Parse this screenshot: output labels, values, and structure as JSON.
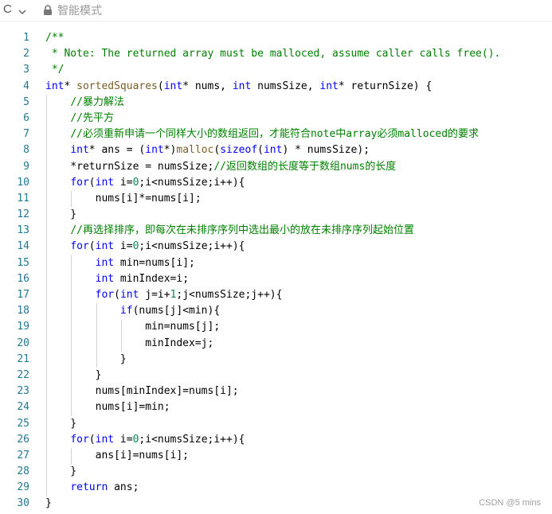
{
  "toolbar": {
    "language_label": "C",
    "mode_label": "智能模式",
    "icons": [
      "chevron-down-icon",
      "lock-icon"
    ]
  },
  "editor": {
    "lines": [
      {
        "n": "1",
        "tokens": [
          {
            "t": "/**",
            "c": "cm"
          }
        ]
      },
      {
        "n": "2",
        "tokens": [
          {
            "t": " * Note: The returned array must be malloced, assume caller calls free().",
            "c": "cm"
          }
        ]
      },
      {
        "n": "3",
        "tokens": [
          {
            "t": " */",
            "c": "cm"
          }
        ]
      },
      {
        "n": "4",
        "tokens": [
          {
            "t": "int",
            "c": "kw"
          },
          {
            "t": "* "
          },
          {
            "t": "sortedSquares",
            "c": "fn"
          },
          {
            "t": "("
          },
          {
            "t": "int",
            "c": "kw"
          },
          {
            "t": "* nums, "
          },
          {
            "t": "int",
            "c": "kw"
          },
          {
            "t": " numsSize, "
          },
          {
            "t": "int",
            "c": "kw"
          },
          {
            "t": "* returnSize) {"
          }
        ]
      },
      {
        "n": "5",
        "tokens": [
          {
            "t": "    "
          },
          {
            "t": "//暴力解法",
            "c": "cm"
          }
        ]
      },
      {
        "n": "6",
        "tokens": [
          {
            "t": "    "
          },
          {
            "t": "//先平方",
            "c": "cm"
          }
        ]
      },
      {
        "n": "7",
        "tokens": [
          {
            "t": "    "
          },
          {
            "t": "//必须重新申请一个同样大小的数组返回，才能符合note中array必须malloced的要求",
            "c": "cm"
          }
        ]
      },
      {
        "n": "8",
        "tokens": [
          {
            "t": "    "
          },
          {
            "t": "int",
            "c": "kw"
          },
          {
            "t": "* ans = ("
          },
          {
            "t": "int",
            "c": "kw"
          },
          {
            "t": "*)"
          },
          {
            "t": "malloc",
            "c": "fn"
          },
          {
            "t": "("
          },
          {
            "t": "sizeof",
            "c": "kw"
          },
          {
            "t": "("
          },
          {
            "t": "int",
            "c": "kw"
          },
          {
            "t": ") * numsSize);"
          }
        ]
      },
      {
        "n": "9",
        "tokens": [
          {
            "t": "    *returnSize = numsSize;"
          },
          {
            "t": "//返回数组的长度等于数组nums的长度",
            "c": "cm"
          }
        ]
      },
      {
        "n": "10",
        "tokens": [
          {
            "t": "    "
          },
          {
            "t": "for",
            "c": "kw"
          },
          {
            "t": "("
          },
          {
            "t": "int",
            "c": "kw"
          },
          {
            "t": " i="
          },
          {
            "t": "0",
            "c": "num"
          },
          {
            "t": ";i<numsSize;i++){"
          }
        ]
      },
      {
        "n": "11",
        "tokens": [
          {
            "t": "        nums[i]*=nums[i];"
          }
        ]
      },
      {
        "n": "12",
        "tokens": [
          {
            "t": "    }"
          }
        ]
      },
      {
        "n": "13",
        "tokens": [
          {
            "t": "    "
          },
          {
            "t": "//再选择排序，即每次在未排序序列中选出最小的放在未排序序列起始位置",
            "c": "cm"
          }
        ]
      },
      {
        "n": "14",
        "tokens": [
          {
            "t": "    "
          },
          {
            "t": "for",
            "c": "kw"
          },
          {
            "t": "("
          },
          {
            "t": "int",
            "c": "kw"
          },
          {
            "t": " i="
          },
          {
            "t": "0",
            "c": "num"
          },
          {
            "t": ";i<numsSize;i++){"
          }
        ]
      },
      {
        "n": "15",
        "tokens": [
          {
            "t": "        "
          },
          {
            "t": "int",
            "c": "kw"
          },
          {
            "t": " min=nums[i];"
          }
        ]
      },
      {
        "n": "16",
        "tokens": [
          {
            "t": "        "
          },
          {
            "t": "int",
            "c": "kw"
          },
          {
            "t": " minIndex=i;"
          }
        ]
      },
      {
        "n": "17",
        "tokens": [
          {
            "t": "        "
          },
          {
            "t": "for",
            "c": "kw"
          },
          {
            "t": "("
          },
          {
            "t": "int",
            "c": "kw"
          },
          {
            "t": " j=i+"
          },
          {
            "t": "1",
            "c": "num"
          },
          {
            "t": ";j<numsSize;j++){"
          }
        ]
      },
      {
        "n": "18",
        "tokens": [
          {
            "t": "            "
          },
          {
            "t": "if",
            "c": "kw"
          },
          {
            "t": "(nums[j]<min){"
          }
        ]
      },
      {
        "n": "19",
        "tokens": [
          {
            "t": "                min=nums[j];"
          }
        ]
      },
      {
        "n": "20",
        "tokens": [
          {
            "t": "                minIndex=j;"
          }
        ]
      },
      {
        "n": "21",
        "tokens": [
          {
            "t": "            }"
          }
        ]
      },
      {
        "n": "22",
        "tokens": [
          {
            "t": "        }"
          }
        ]
      },
      {
        "n": "23",
        "tokens": [
          {
            "t": "        nums[minIndex]=nums[i];"
          }
        ]
      },
      {
        "n": "24",
        "tokens": [
          {
            "t": "        nums[i]=min;"
          }
        ]
      },
      {
        "n": "25",
        "tokens": [
          {
            "t": "    }"
          }
        ]
      },
      {
        "n": "26",
        "tokens": [
          {
            "t": "    "
          },
          {
            "t": "for",
            "c": "kw"
          },
          {
            "t": "("
          },
          {
            "t": "int",
            "c": "kw"
          },
          {
            "t": " i="
          },
          {
            "t": "0",
            "c": "num"
          },
          {
            "t": ";i<numsSize;i++){"
          }
        ]
      },
      {
        "n": "27",
        "tokens": [
          {
            "t": "        ans[i]=nums[i];"
          }
        ]
      },
      {
        "n": "28",
        "tokens": [
          {
            "t": "    }"
          }
        ]
      },
      {
        "n": "29",
        "tokens": [
          {
            "t": "    "
          },
          {
            "t": "return",
            "c": "kw"
          },
          {
            "t": " ans;"
          }
        ]
      },
      {
        "n": "30",
        "tokens": [
          {
            "t": "}"
          }
        ]
      }
    ]
  },
  "watermark": "CSDN @5 mins",
  "colors": {
    "keyword": "#0000ff",
    "comment": "#008000",
    "function": "#795e26",
    "number": "#098658",
    "line_number": "#237893"
  }
}
